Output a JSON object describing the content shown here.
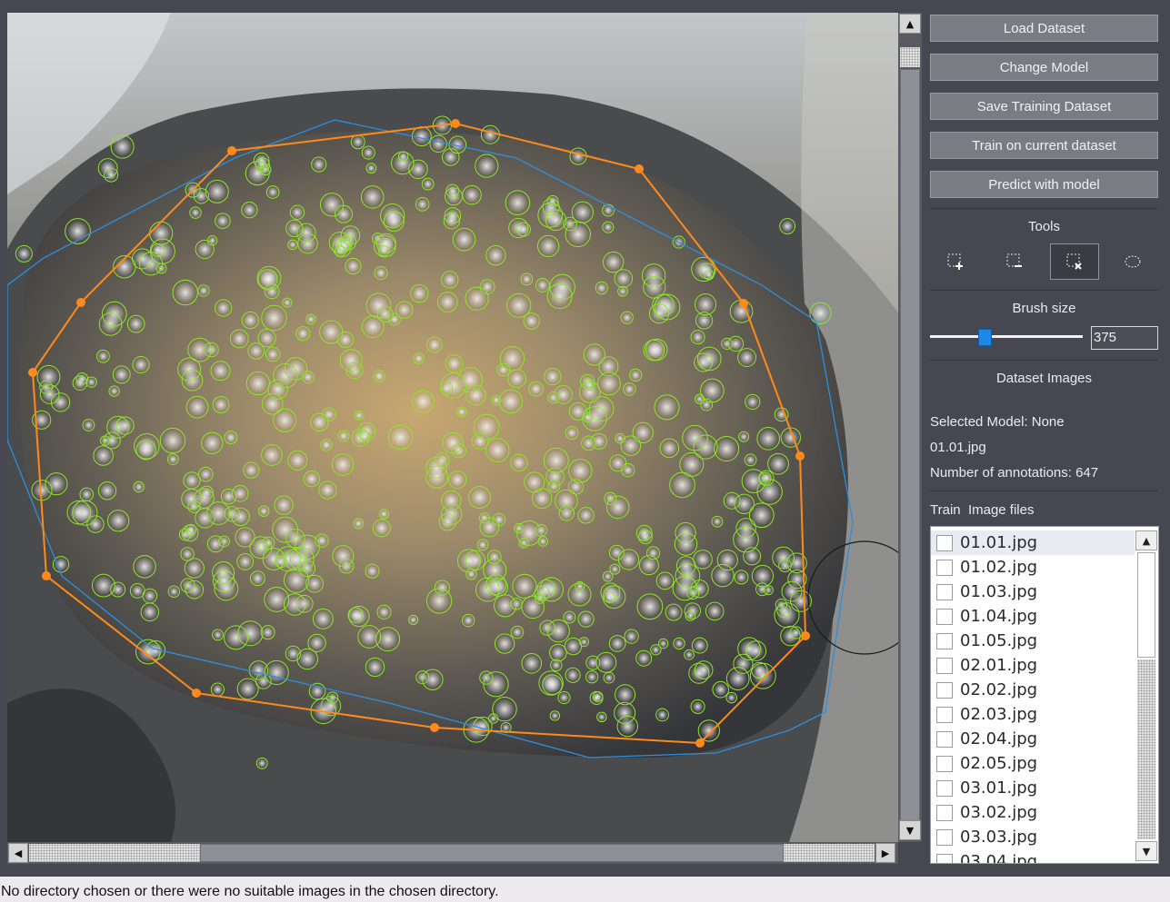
{
  "buttons": {
    "load_dataset": "Load Dataset",
    "change_model": "Change Model",
    "save_training": "Save Training Dataset",
    "train": "Train on current dataset",
    "predict": "Predict with model"
  },
  "tools": {
    "title": "Tools",
    "items": [
      {
        "name": "add-box-tool-icon",
        "active": false
      },
      {
        "name": "remove-box-tool-icon",
        "active": false
      },
      {
        "name": "delete-box-tool-icon",
        "active": true
      },
      {
        "name": "ellipse-tool-icon",
        "active": false
      }
    ]
  },
  "brush": {
    "title": "Brush size",
    "value": "375",
    "level_fraction": 0.36
  },
  "dataset": {
    "title": "Dataset Images",
    "selected_model": "Selected Model: None",
    "current_file": "01.01.jpg",
    "annotations": "Number of annotations: 647"
  },
  "file_list": {
    "title": "Train  Image files",
    "items": [
      "01.01.jpg",
      "01.02.jpg",
      "01.03.jpg",
      "01.04.jpg",
      "01.05.jpg",
      "02.01.jpg",
      "02.02.jpg",
      "02.03.jpg",
      "02.04.jpg",
      "02.05.jpg",
      "03.01.jpg",
      "03.02.jpg",
      "03.03.jpg",
      "03.04.jpg"
    ],
    "selected_index": 0
  },
  "status": "No directory chosen or there were no suitable images in the chosen directory.",
  "colors": {
    "outline_orange": "#ff8a1c",
    "outline_blue": "#2d8fe0",
    "annotation_green": "#8ee62a"
  }
}
